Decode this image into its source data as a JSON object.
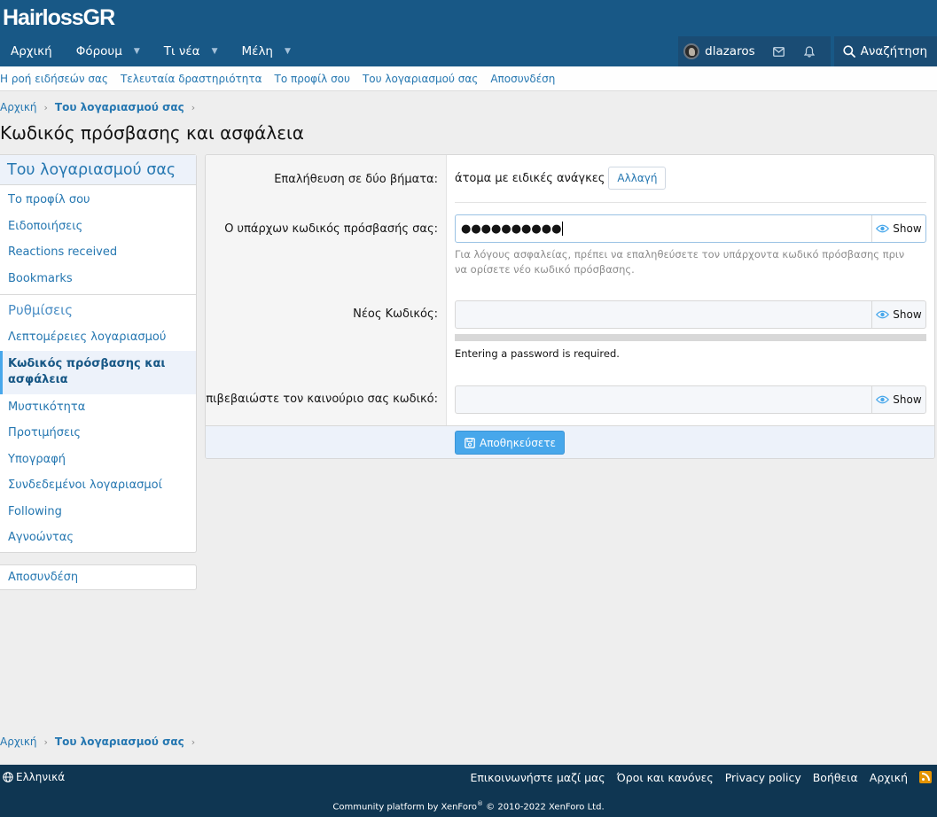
{
  "site": {
    "logo": "HairlossGR"
  },
  "nav": {
    "items": [
      {
        "label": "Αρχική",
        "caret": false
      },
      {
        "label": "Φόρουμ",
        "caret": true
      },
      {
        "label": "Τι νέα",
        "caret": true
      },
      {
        "label": "Μέλη",
        "caret": true
      }
    ],
    "user": "dlazaros",
    "search": "Αναζήτηση"
  },
  "subnav": [
    "Η ροή ειδήσεών σας",
    "Τελευταία δραστηριότητα",
    "Το προφίλ σου",
    "Του λογαριασμού σας",
    "Αποσυνδέση"
  ],
  "breadcrumb": {
    "home": "Αρχική",
    "current": "Του λογαριασμού σας",
    "sep": "›"
  },
  "page": {
    "title": "Κωδικός πρόσβασης και ασφάλεια"
  },
  "sidebar": {
    "heading": "Του λογαριασμού σας",
    "group1": [
      "Το προφίλ σου",
      "Ειδοποιήσεις",
      "Reactions received",
      "Bookmarks"
    ],
    "settings_heading": "Ρυθμίσεις",
    "group2_before": [
      "Λεπτομέρειες λογαριασμού"
    ],
    "active": "Κωδικός πρόσβασης και ασφάλεια",
    "group2_after": [
      "Μυστικότητα",
      "Προτιμήσεις",
      "Υπογραφή",
      "Συνδεδεμένοι λογαριασμοί",
      "Following",
      "Αγνοώντας"
    ],
    "logout": "Αποσυνδέση"
  },
  "form": {
    "two_step": {
      "label": "Επαλήθευση σε δύο βήματα:",
      "value": "άτομα με ειδικές ανάγκες",
      "button": "Αλλαγή"
    },
    "current_pw": {
      "label": "Ο υπάρχων κωδικός πρόσβασής σας:",
      "value": "●●●●●●●●●●",
      "hint": "Για λόγους ασφαλείας, πρέπει να επαληθεύσετε τον υπάρχοντα κωδικό πρόσβασης πριν να ορίσετε νέο κωδικό πρόσβασης."
    },
    "new_pw": {
      "label": "Νέος Κωδικός:",
      "value": "",
      "strength_msg": "Entering a password is required.",
      "strength": 0
    },
    "confirm_pw": {
      "label": "Επιβεβαιώστε τον καινούριο σας κωδικό:",
      "value": ""
    },
    "show_label": "Show",
    "save": "Αποθηκεύσετε"
  },
  "footer": {
    "language": "Ελληνικά",
    "links": [
      "Επικοινωνήστε μαζί μας",
      "Όροι και κανόνες",
      "Privacy policy",
      "Βοήθεια",
      "Αρχική"
    ],
    "copyright_pre": "Community platform by XenForo",
    "copyright_reg": "®",
    "copyright_post": " © 2010-2022 XenForo Ltd."
  },
  "colors": {
    "header": "#185886",
    "accent": "#2577b1",
    "button": "#47a7eb",
    "footer": "#0f3652"
  }
}
